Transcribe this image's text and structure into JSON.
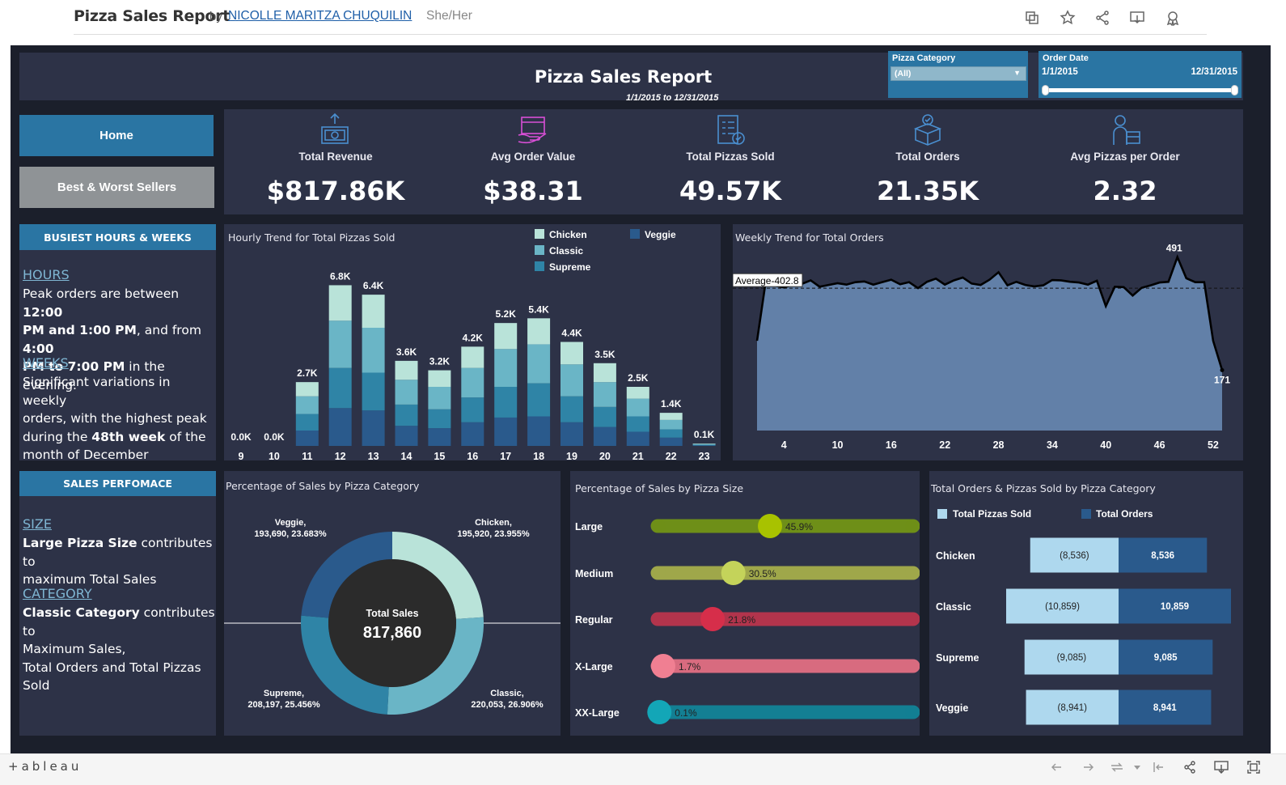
{
  "top": {
    "title": "Pizza Sales Report",
    "by": "by",
    "author": "NICOLLE MARITZA CHUQUILIN",
    "pronouns": "She/Her"
  },
  "header": {
    "title": "Pizza Sales Report",
    "date_range": "1/1/2015 to 12/31/2015"
  },
  "filters": {
    "category_label": "Pizza Category",
    "category_value": "(All)",
    "date_label": "Order Date",
    "date_start": "1/1/2015",
    "date_end": "12/31/2015"
  },
  "nav": {
    "home": "Home",
    "best_worst": "Best & Worst Sellers"
  },
  "kpis": [
    {
      "label": "Total Revenue",
      "value": "$817.86K",
      "icon": "revenue-icon"
    },
    {
      "label": "Avg Order Value",
      "value": "$38.31",
      "icon": "order-value-icon"
    },
    {
      "label": "Total Pizzas Sold",
      "value": "49.57K",
      "icon": "pizzas-sold-icon"
    },
    {
      "label": "Total Orders",
      "value": "21.35K",
      "icon": "orders-box-icon"
    },
    {
      "label": "Avg Pizzas per Order",
      "value": "2.32",
      "icon": "delivery-icon"
    }
  ],
  "busiest": {
    "header": "BUSIEST HOURS & WEEKS",
    "hours_link": "HOURS",
    "hours_lines": [
      "Peak orders are between 12:00",
      "PM and 1:00 PM, and from 4:00",
      "PM to 7:00 PM in the evening."
    ],
    "weeks_link": "WEEKS",
    "weeks_lines": [
      "Significant variations in weekly",
      "orders, with the highest peak",
      "during the 48th week of the",
      "month of December"
    ]
  },
  "sales_perf": {
    "header": "SALES PERFOMACE",
    "size_link": "SIZE",
    "size_lines": [
      "Large Pizza Size contributes to",
      "maximum Total Sales"
    ],
    "cat_link": "CATEGORY",
    "cat_lines": [
      "Classic Category contributes to",
      "Maximum Sales,",
      "Total Orders and Total Pizzas",
      "Sold"
    ]
  },
  "colors": {
    "chicken": "#b9e3d9",
    "classic": "#6ab5c6",
    "supreme": "#2f84a6",
    "veggie": "#2a5a8c",
    "bg": "#2d3247"
  },
  "chart_data": [
    {
      "type": "bar",
      "stacked": true,
      "title": "Hourly Trend for Total Pizzas Sold",
      "categories": [
        "9",
        "10",
        "11",
        "12",
        "13",
        "14",
        "15",
        "16",
        "17",
        "18",
        "19",
        "20",
        "21",
        "22",
        "23"
      ],
      "totals_labels": [
        "0.0K",
        "0.0K",
        "2.7K",
        "6.8K",
        "6.4K",
        "3.6K",
        "3.2K",
        "4.2K",
        "5.2K",
        "5.4K",
        "4.4K",
        "3.5K",
        "2.5K",
        "1.4K",
        "0.1K"
      ],
      "series": [
        {
          "name": "Veggie",
          "values": [
            0,
            0,
            0.65,
            1.6,
            1.5,
            0.85,
            0.75,
            1.0,
            1.2,
            1.25,
            1.0,
            0.8,
            0.6,
            0.35,
            0.02
          ]
        },
        {
          "name": "Supreme",
          "values": [
            0,
            0,
            0.7,
            1.7,
            1.6,
            0.9,
            0.8,
            1.05,
            1.3,
            1.4,
            1.1,
            0.85,
            0.65,
            0.35,
            0.03
          ]
        },
        {
          "name": "Classic",
          "values": [
            0,
            0,
            0.75,
            2.0,
            1.9,
            1.05,
            0.95,
            1.25,
            1.6,
            1.65,
            1.35,
            1.05,
            0.75,
            0.4,
            0.03
          ]
        },
        {
          "name": "Chicken",
          "values": [
            0,
            0,
            0.6,
            1.5,
            1.4,
            0.8,
            0.7,
            0.9,
            1.1,
            1.1,
            0.95,
            0.8,
            0.5,
            0.3,
            0.02
          ]
        }
      ],
      "legend": [
        "Chicken",
        "Classic",
        "Supreme",
        "Veggie"
      ],
      "ylim": [
        0,
        7.5
      ]
    },
    {
      "type": "area",
      "title": "Weekly Trend for Total Orders",
      "x": [
        1,
        2,
        3,
        4,
        5,
        6,
        7,
        8,
        9,
        10,
        11,
        12,
        13,
        14,
        15,
        16,
        17,
        18,
        19,
        20,
        21,
        22,
        23,
        24,
        25,
        26,
        27,
        28,
        29,
        30,
        31,
        32,
        33,
        34,
        35,
        36,
        37,
        38,
        39,
        40,
        41,
        42,
        43,
        44,
        45,
        46,
        47,
        48,
        49,
        50,
        51,
        52,
        53
      ],
      "y": [
        254,
        427,
        410,
        405,
        412,
        415,
        425,
        407,
        412,
        417,
        413,
        420,
        422,
        413,
        420,
        427,
        414,
        420,
        403,
        421,
        430,
        413,
        425,
        433,
        416,
        412,
        427,
        448,
        411,
        421,
        412,
        408,
        411,
        426,
        425,
        421,
        419,
        413,
        424,
        352,
        407,
        406,
        382,
        404,
        411,
        419,
        421,
        491,
        431,
        420,
        420,
        254,
        171
      ],
      "xticks": [
        4,
        10,
        16,
        22,
        28,
        34,
        40,
        46,
        52
      ],
      "average": 402.8,
      "average_label": "Average-402.8",
      "max_label": "491",
      "min_label": "171",
      "ylim": [
        0,
        520
      ]
    },
    {
      "type": "pie",
      "donut": true,
      "title": "Percentage of Sales by Pizza Category",
      "center_label": "Total Sales",
      "center_value": "817,860",
      "slices": [
        {
          "name": "Chicken",
          "value": 195920,
          "pct": "23.955%",
          "label": "Chicken,",
          "sub": "195,920, 23.955%"
        },
        {
          "name": "Classic",
          "value": 220053,
          "pct": "26.906%",
          "label": "Classic,",
          "sub": "220,053, 26.906%"
        },
        {
          "name": "Supreme",
          "value": 208197,
          "pct": "25.456%",
          "label": "Supreme,",
          "sub": "208,197, 25.456%"
        },
        {
          "name": "Veggie",
          "value": 193690,
          "pct": "23.683%",
          "label": "Veggie,",
          "sub": "193,690, 23.683%"
        }
      ]
    },
    {
      "type": "bar",
      "title": "Percentage of Sales by Pizza Size",
      "categories": [
        "Large",
        "Medium",
        "Regular",
        "X-Large",
        "XX-Large"
      ],
      "values": [
        45.9,
        30.5,
        21.8,
        1.7,
        0.1
      ],
      "labels": [
        "45.9%",
        "30.5%",
        "21.8%",
        "1.7%",
        "0.1%"
      ],
      "colors": [
        "#6e8f18",
        "#9fa74a",
        "#b2344c",
        "#d86b7f",
        "#137f93"
      ],
      "dot_colors": [
        "#a8c200",
        "#c4d35a",
        "#d62e4a",
        "#f07f92",
        "#13a6b7"
      ]
    },
    {
      "type": "bar",
      "title": "Total Orders & Pizzas Sold by Pizza Category",
      "legend": [
        "Total Pizzas Sold",
        "Total Orders"
      ],
      "categories": [
        "Chicken",
        "Classic",
        "Supreme",
        "Veggie"
      ],
      "series": [
        {
          "name": "Total Pizzas Sold",
          "values": [
            8536,
            10859,
            9085,
            8941
          ],
          "labels": [
            "(8,536)",
            "(10,859)",
            "(9,085)",
            "(8,941)"
          ]
        },
        {
          "name": "Total Orders",
          "values": [
            8536,
            10859,
            9085,
            8941
          ],
          "labels": [
            "8,536",
            "10,859",
            "9,085",
            "8,941"
          ]
        }
      ]
    }
  ],
  "footer": {
    "logo": "+ableau"
  }
}
